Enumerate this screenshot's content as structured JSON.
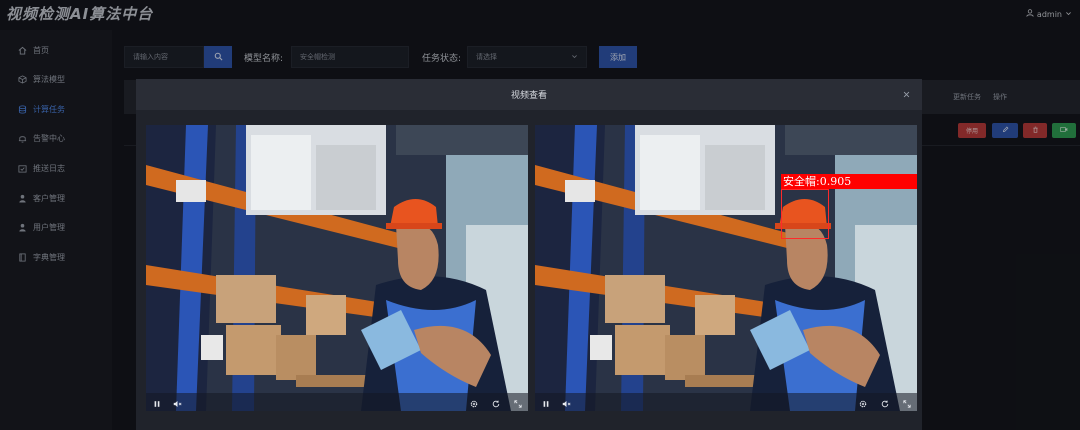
{
  "app": {
    "title": "视频检测AI算法中台"
  },
  "user": {
    "name": "admin"
  },
  "sidebar": {
    "items": [
      {
        "label": "首页",
        "icon": "home-icon",
        "active": false
      },
      {
        "label": "算法模型",
        "icon": "cube-icon",
        "active": false
      },
      {
        "label": "计算任务",
        "icon": "database-icon",
        "active": true
      },
      {
        "label": "告警中心",
        "icon": "bell-icon",
        "active": false
      },
      {
        "label": "推送日志",
        "icon": "calendar-check-icon",
        "active": false
      },
      {
        "label": "客户管理",
        "icon": "user-icon",
        "active": false
      },
      {
        "label": "用户管理",
        "icon": "user-icon",
        "active": false
      },
      {
        "label": "字典管理",
        "icon": "book-icon",
        "active": false
      }
    ]
  },
  "filters": {
    "search_placeholder": "请输入内容",
    "model_label": "模型名称:",
    "model_placeholder": "安全帽检测",
    "status_label": "任务状态:",
    "status_value": "请选择",
    "add_label": "添加"
  },
  "table": {
    "headers": [
      "更新任务",
      "操作"
    ],
    "row_actions": [
      "停用",
      "",
      "",
      ""
    ]
  },
  "modal": {
    "title": "视频查看",
    "detection": {
      "label": "安全帽:0.905",
      "class": "安全帽",
      "confidence": 0.905
    }
  },
  "colors": {
    "accent": "#2f54a8",
    "active_nav": "#4e86e6",
    "detection": "#ff0000",
    "danger": "#b53a3a",
    "success": "#2f9a52"
  }
}
